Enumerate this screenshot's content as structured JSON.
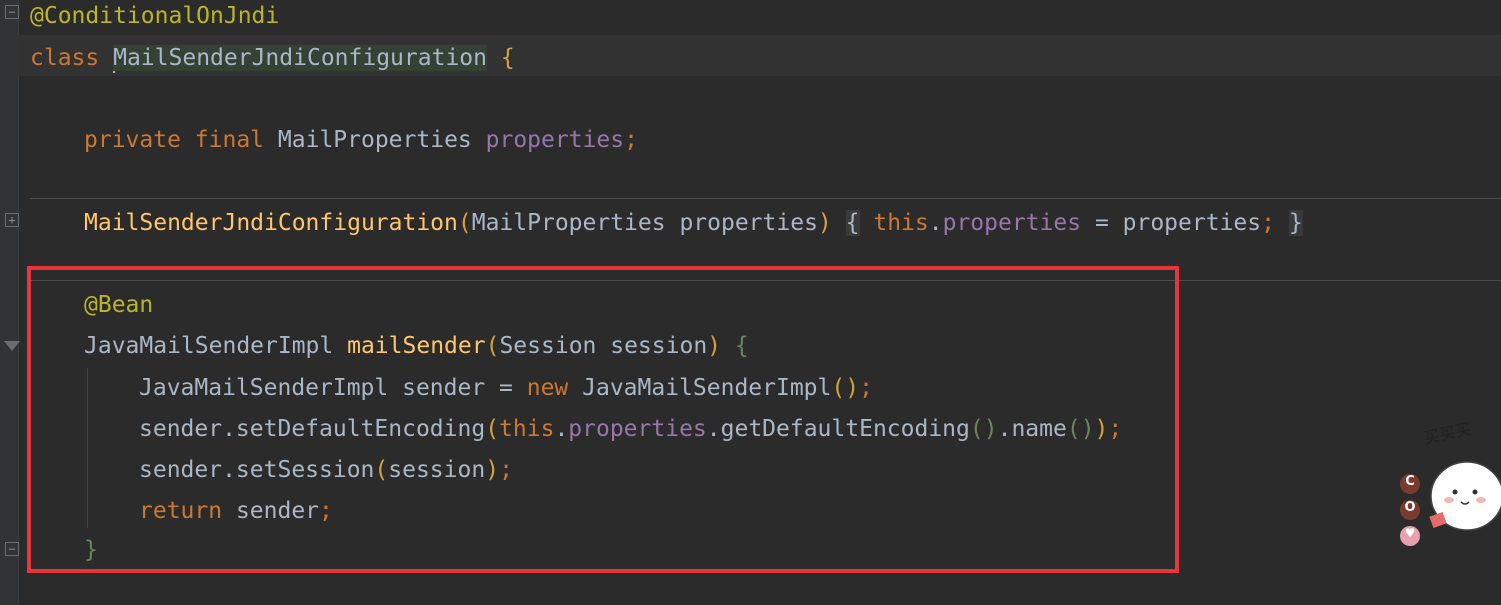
{
  "editor": {
    "lines": {
      "l1": {
        "annotation": "@ConditionalOnJndi"
      },
      "l2": {
        "kw": "class",
        "name": "MailSenderJndiConfiguration",
        "brace": "{"
      },
      "l3": {
        "private": "private",
        "final": "final",
        "type": "MailProperties",
        "field": "properties",
        "semi": ";"
      },
      "l4": {
        "ctor": "MailSenderJndiConfiguration",
        "lp": "(",
        "params": "MailProperties properties",
        "rp": ")",
        "ob": "{",
        "this": "this",
        "dot": ".",
        "field": "properties",
        "assign": " = properties",
        "semi": ";",
        "cb": "}"
      },
      "l5": {
        "annotation": "@Bean"
      },
      "l6": {
        "type": "JavaMailSenderImpl",
        "method": "mailSender",
        "lp": "(",
        "params": "Session session",
        "rp": ")",
        "brace": "{"
      },
      "l7": {
        "decl": "JavaMailSenderImpl sender = ",
        "new": "new",
        "ctype": " JavaMailSenderImpl",
        "parens": "()",
        "semi": ";"
      },
      "l8": {
        "pre": "sender.setDefaultEncoding",
        "lp": "(",
        "this": "this",
        "dot": ".",
        "field": "properties",
        "call": ".getDefaultEncoding",
        "p1": "()",
        "call2": ".name",
        "p2": "()",
        "rp": ")",
        "semi": ";"
      },
      "l9": {
        "pre": "sender.setSession",
        "lp": "(",
        "arg": "session",
        "rp": ")",
        "semi": ";"
      },
      "l10": {
        "ret": "return",
        "val": " sender",
        "semi": ";"
      },
      "l11": {
        "brace": "}"
      }
    }
  },
  "sticker": {
    "caption": "买买买",
    "badges": [
      "C",
      "O",
      "♥"
    ]
  },
  "colors": {
    "background": "#2b2b2b",
    "keyword": "#cc7832",
    "annotation": "#bbb529",
    "field": "#9876aa",
    "method": "#ffc66d",
    "plain": "#a9b7c6",
    "highlight_box": "#e8343a"
  }
}
